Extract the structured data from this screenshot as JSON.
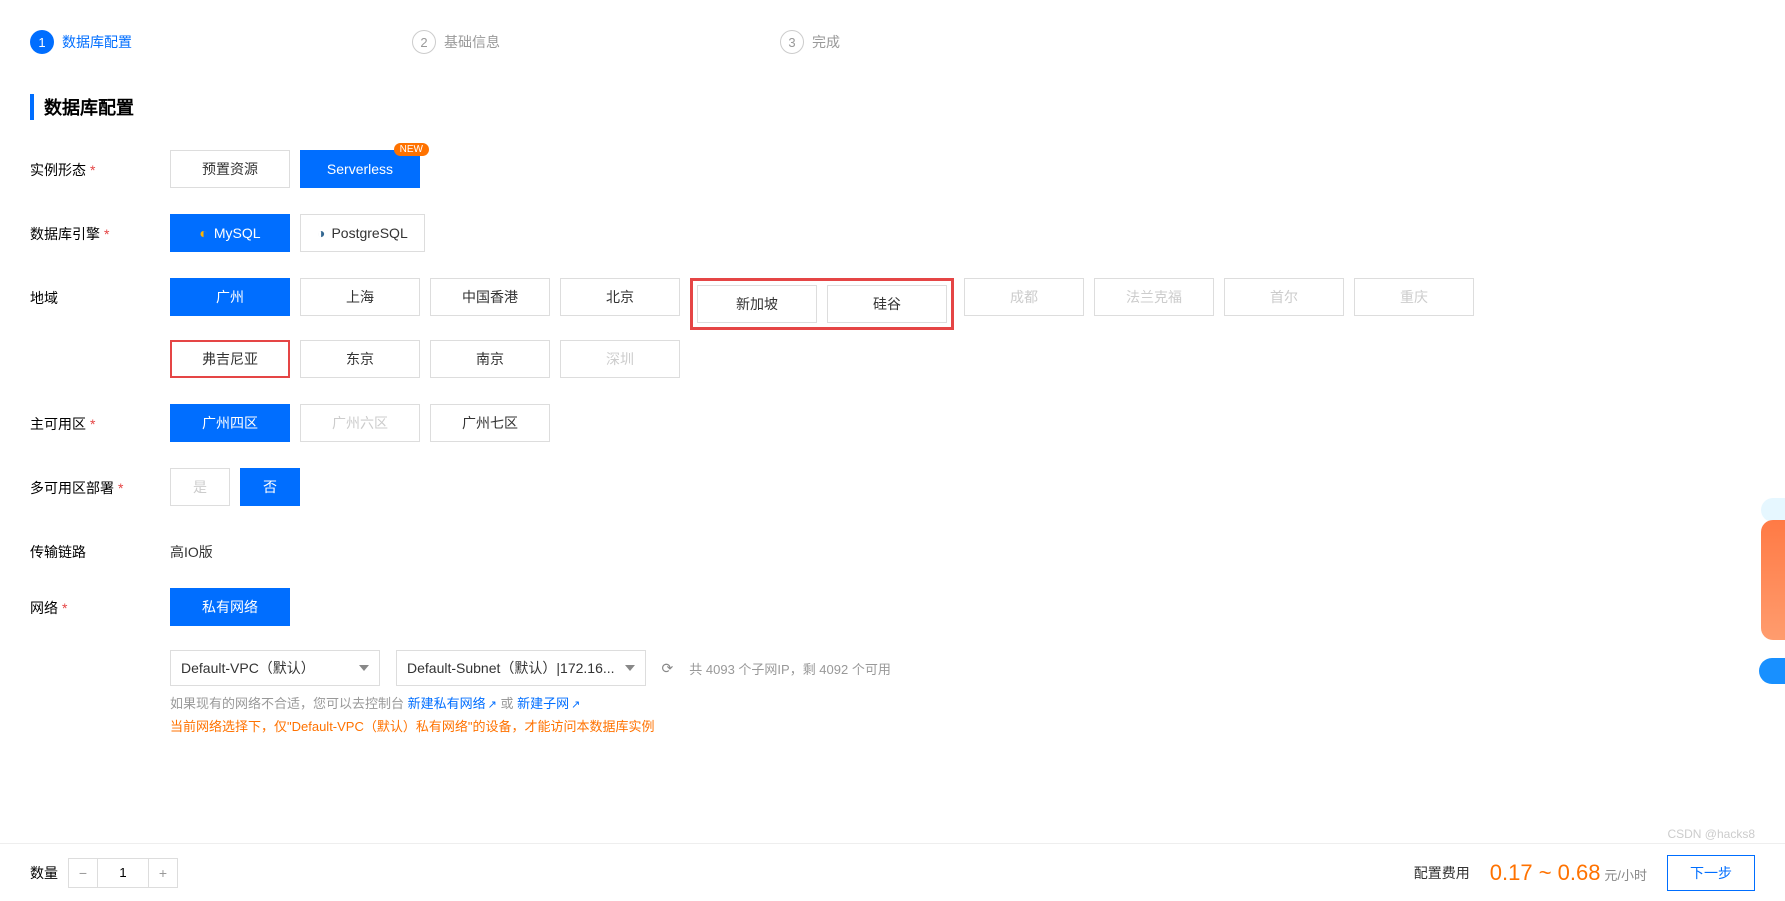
{
  "steps": [
    {
      "num": "1",
      "label": "数据库配置",
      "active": true
    },
    {
      "num": "2",
      "label": "基础信息",
      "active": false
    },
    {
      "num": "3",
      "label": "完成",
      "active": false
    }
  ],
  "section_title": "数据库配置",
  "labels": {
    "instance_type": "实例形态",
    "db_engine": "数据库引擎",
    "region": "地域",
    "main_az": "主可用区",
    "multi_az": "多可用区部署",
    "transport": "传输链路",
    "network": "网络"
  },
  "instance_type": {
    "preset": "预置资源",
    "serverless": "Serverless",
    "new_badge": "NEW"
  },
  "engine": {
    "mysql": "MySQL",
    "postgres": "PostgreSQL"
  },
  "region": {
    "r0": "广州",
    "r1": "上海",
    "r2": "中国香港",
    "r3": "北京",
    "r4": "新加坡",
    "r5": "硅谷",
    "r6": "成都",
    "r7": "法兰克福",
    "r8": "首尔",
    "r9": "重庆",
    "r10": "弗吉尼亚",
    "r11": "东京",
    "r12": "南京",
    "r13": "深圳"
  },
  "main_az": {
    "z0": "广州四区",
    "z1": "广州六区",
    "z2": "广州七区"
  },
  "multi_az": {
    "yes": "是",
    "no": "否"
  },
  "transport_value": "高IO版",
  "network": {
    "private": "私有网络"
  },
  "selects": {
    "vpc": "Default-VPC（默认）",
    "subnet": "Default-Subnet（默认）|172.16...",
    "subnet_note": "共 4093 个子网IP，剩 4092 个可用"
  },
  "help": {
    "line1a": "如果现有的网络不合适，您可以去控制台 ",
    "link1": "新建私有网络",
    "sep": " 或 ",
    "link2": "新建子网",
    "line2": "当前网络选择下，仅\"Default-VPC（默认）私有网络\"的设备，才能访问本数据库实例"
  },
  "footer": {
    "qty_label": "数量",
    "qty_value": "1",
    "price_label": "配置费用",
    "price_value": "0.17 ~ 0.68",
    "price_unit": "元/小时",
    "next": "下一步"
  },
  "watermark": "CSDN @hacks8"
}
